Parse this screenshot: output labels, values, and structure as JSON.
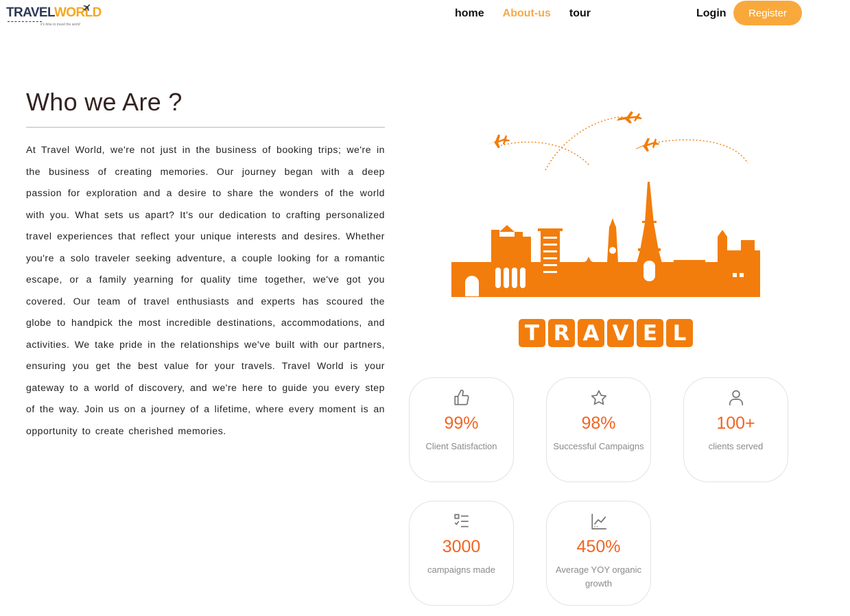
{
  "header": {
    "logo": {
      "word1": "TRAVEL",
      "word2": "WORLD",
      "tagline": "it's time to travel the world",
      "icon": "airplane-icon"
    },
    "nav": [
      {
        "label": "home",
        "active": false
      },
      {
        "label": "About-us",
        "active": true
      },
      {
        "label": "tour",
        "active": false
      }
    ],
    "login_label": "Login",
    "register_label": "Register"
  },
  "about": {
    "title": "Who we Are ?",
    "body": "At Travel World, we're not just in the business of booking trips; we're in the business of creating memories. Our journey began with a deep passion for exploration and a desire to share the wonders of the world with you. What sets us apart? It's our dedication to crafting personalized travel experiences that reflect your unique interests and desires. Whether you're a solo traveler seeking adventure, a couple looking for a romantic escape, or a family yearning for quality time together, we've got you covered. Our team of travel enthusiasts and experts has scoured the globe to handpick the most incredible destinations, accommodations, and activities. We take pride in the relationships we've built with our partners, ensuring you get the best value for your travels. Travel World is your gateway to a world of discovery, and we're here to guide you every step of the way. Join us on a journey of a lifetime, where every moment is an opportunity to create cherished memories."
  },
  "illustration": {
    "letters": [
      "T",
      "R",
      "A",
      "V",
      "E",
      "L"
    ],
    "color": "#f27d0c"
  },
  "stats": [
    {
      "icon": "thumbs-up-icon",
      "value": "99%",
      "label": "Client Satisfaction"
    },
    {
      "icon": "star-icon",
      "value": "98%",
      "label": "Successful Campaigns"
    },
    {
      "icon": "user-icon",
      "value": "100+",
      "label": "clients served"
    },
    {
      "icon": "checklist-icon",
      "value": "3000",
      "label": "campaigns made"
    },
    {
      "icon": "growth-chart-icon",
      "value": "450%",
      "label": "Average YOY organic growth"
    }
  ],
  "colors": {
    "accent": "#f9a93c",
    "stat_value": "#f26522",
    "nav_active": "#f5a94a"
  }
}
